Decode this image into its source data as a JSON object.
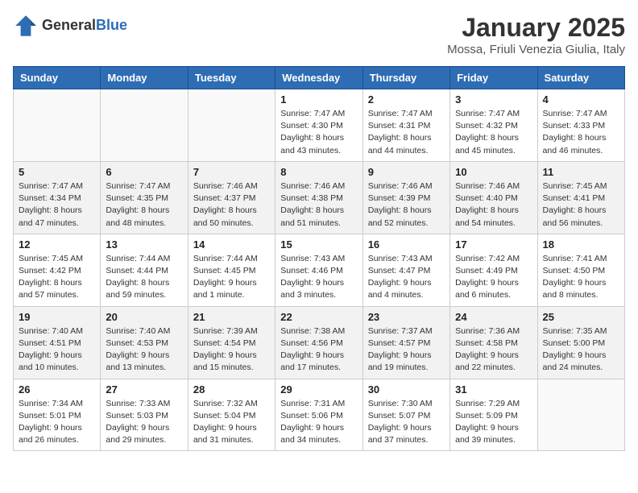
{
  "header": {
    "logo_general": "General",
    "logo_blue": "Blue",
    "title": "January 2025",
    "subtitle": "Mossa, Friuli Venezia Giulia, Italy"
  },
  "days_of_week": [
    "Sunday",
    "Monday",
    "Tuesday",
    "Wednesday",
    "Thursday",
    "Friday",
    "Saturday"
  ],
  "weeks": [
    [
      {
        "day": "",
        "info": ""
      },
      {
        "day": "",
        "info": ""
      },
      {
        "day": "",
        "info": ""
      },
      {
        "day": "1",
        "info": "Sunrise: 7:47 AM\nSunset: 4:30 PM\nDaylight: 8 hours\nand 43 minutes."
      },
      {
        "day": "2",
        "info": "Sunrise: 7:47 AM\nSunset: 4:31 PM\nDaylight: 8 hours\nand 44 minutes."
      },
      {
        "day": "3",
        "info": "Sunrise: 7:47 AM\nSunset: 4:32 PM\nDaylight: 8 hours\nand 45 minutes."
      },
      {
        "day": "4",
        "info": "Sunrise: 7:47 AM\nSunset: 4:33 PM\nDaylight: 8 hours\nand 46 minutes."
      }
    ],
    [
      {
        "day": "5",
        "info": "Sunrise: 7:47 AM\nSunset: 4:34 PM\nDaylight: 8 hours\nand 47 minutes."
      },
      {
        "day": "6",
        "info": "Sunrise: 7:47 AM\nSunset: 4:35 PM\nDaylight: 8 hours\nand 48 minutes."
      },
      {
        "day": "7",
        "info": "Sunrise: 7:46 AM\nSunset: 4:37 PM\nDaylight: 8 hours\nand 50 minutes."
      },
      {
        "day": "8",
        "info": "Sunrise: 7:46 AM\nSunset: 4:38 PM\nDaylight: 8 hours\nand 51 minutes."
      },
      {
        "day": "9",
        "info": "Sunrise: 7:46 AM\nSunset: 4:39 PM\nDaylight: 8 hours\nand 52 minutes."
      },
      {
        "day": "10",
        "info": "Sunrise: 7:46 AM\nSunset: 4:40 PM\nDaylight: 8 hours\nand 54 minutes."
      },
      {
        "day": "11",
        "info": "Sunrise: 7:45 AM\nSunset: 4:41 PM\nDaylight: 8 hours\nand 56 minutes."
      }
    ],
    [
      {
        "day": "12",
        "info": "Sunrise: 7:45 AM\nSunset: 4:42 PM\nDaylight: 8 hours\nand 57 minutes."
      },
      {
        "day": "13",
        "info": "Sunrise: 7:44 AM\nSunset: 4:44 PM\nDaylight: 8 hours\nand 59 minutes."
      },
      {
        "day": "14",
        "info": "Sunrise: 7:44 AM\nSunset: 4:45 PM\nDaylight: 9 hours\nand 1 minute."
      },
      {
        "day": "15",
        "info": "Sunrise: 7:43 AM\nSunset: 4:46 PM\nDaylight: 9 hours\nand 3 minutes."
      },
      {
        "day": "16",
        "info": "Sunrise: 7:43 AM\nSunset: 4:47 PM\nDaylight: 9 hours\nand 4 minutes."
      },
      {
        "day": "17",
        "info": "Sunrise: 7:42 AM\nSunset: 4:49 PM\nDaylight: 9 hours\nand 6 minutes."
      },
      {
        "day": "18",
        "info": "Sunrise: 7:41 AM\nSunset: 4:50 PM\nDaylight: 9 hours\nand 8 minutes."
      }
    ],
    [
      {
        "day": "19",
        "info": "Sunrise: 7:40 AM\nSunset: 4:51 PM\nDaylight: 9 hours\nand 10 minutes."
      },
      {
        "day": "20",
        "info": "Sunrise: 7:40 AM\nSunset: 4:53 PM\nDaylight: 9 hours\nand 13 minutes."
      },
      {
        "day": "21",
        "info": "Sunrise: 7:39 AM\nSunset: 4:54 PM\nDaylight: 9 hours\nand 15 minutes."
      },
      {
        "day": "22",
        "info": "Sunrise: 7:38 AM\nSunset: 4:56 PM\nDaylight: 9 hours\nand 17 minutes."
      },
      {
        "day": "23",
        "info": "Sunrise: 7:37 AM\nSunset: 4:57 PM\nDaylight: 9 hours\nand 19 minutes."
      },
      {
        "day": "24",
        "info": "Sunrise: 7:36 AM\nSunset: 4:58 PM\nDaylight: 9 hours\nand 22 minutes."
      },
      {
        "day": "25",
        "info": "Sunrise: 7:35 AM\nSunset: 5:00 PM\nDaylight: 9 hours\nand 24 minutes."
      }
    ],
    [
      {
        "day": "26",
        "info": "Sunrise: 7:34 AM\nSunset: 5:01 PM\nDaylight: 9 hours\nand 26 minutes."
      },
      {
        "day": "27",
        "info": "Sunrise: 7:33 AM\nSunset: 5:03 PM\nDaylight: 9 hours\nand 29 minutes."
      },
      {
        "day": "28",
        "info": "Sunrise: 7:32 AM\nSunset: 5:04 PM\nDaylight: 9 hours\nand 31 minutes."
      },
      {
        "day": "29",
        "info": "Sunrise: 7:31 AM\nSunset: 5:06 PM\nDaylight: 9 hours\nand 34 minutes."
      },
      {
        "day": "30",
        "info": "Sunrise: 7:30 AM\nSunset: 5:07 PM\nDaylight: 9 hours\nand 37 minutes."
      },
      {
        "day": "31",
        "info": "Sunrise: 7:29 AM\nSunset: 5:09 PM\nDaylight: 9 hours\nand 39 minutes."
      },
      {
        "day": "",
        "info": ""
      }
    ]
  ]
}
